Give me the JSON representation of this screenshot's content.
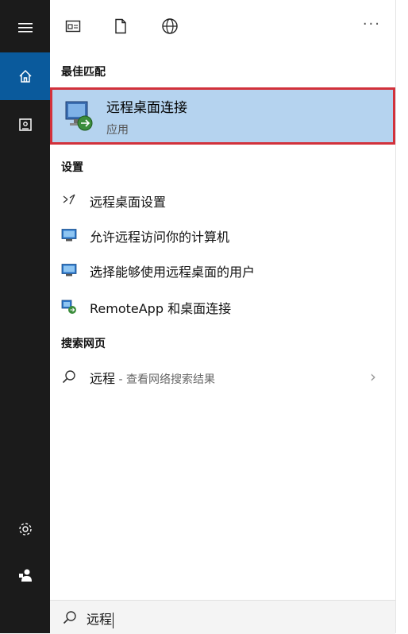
{
  "sidebar": {
    "items": [
      {
        "icon": "hamburger-icon"
      },
      {
        "icon": "home-icon",
        "active": true
      },
      {
        "icon": "notebook-icon"
      },
      {
        "icon": "settings-icon"
      },
      {
        "icon": "user-icon"
      }
    ]
  },
  "toolbar": {
    "icons": [
      "app-window-icon",
      "document-icon",
      "globe-icon",
      "more-icon"
    ],
    "more_label": "···"
  },
  "best_match": {
    "heading": "最佳匹配",
    "title": "远程桌面连接",
    "subtitle": "应用",
    "icon": "remote-desktop-icon"
  },
  "settings": {
    "heading": "设置",
    "items": [
      {
        "label": "远程桌面设置",
        "icon": "remote-settings-icon"
      },
      {
        "label": "允许远程访问你的计算机",
        "icon": "monitor-icon"
      },
      {
        "label": "选择能够使用远程桌面的用户",
        "icon": "monitor-icon"
      },
      {
        "label": "RemoteApp 和桌面连接",
        "icon": "remoteapp-icon"
      }
    ]
  },
  "web": {
    "heading": "搜索网页",
    "query": "远程",
    "suffix": " - 查看网络搜索结果",
    "chevron": "›"
  },
  "search": {
    "value": "远程"
  },
  "colors": {
    "sidebar_bg": "#1b1b1b",
    "active_bg": "#0a5a9c",
    "highlight_bg": "#b5d3ef",
    "highlight_border": "#d2313b"
  }
}
